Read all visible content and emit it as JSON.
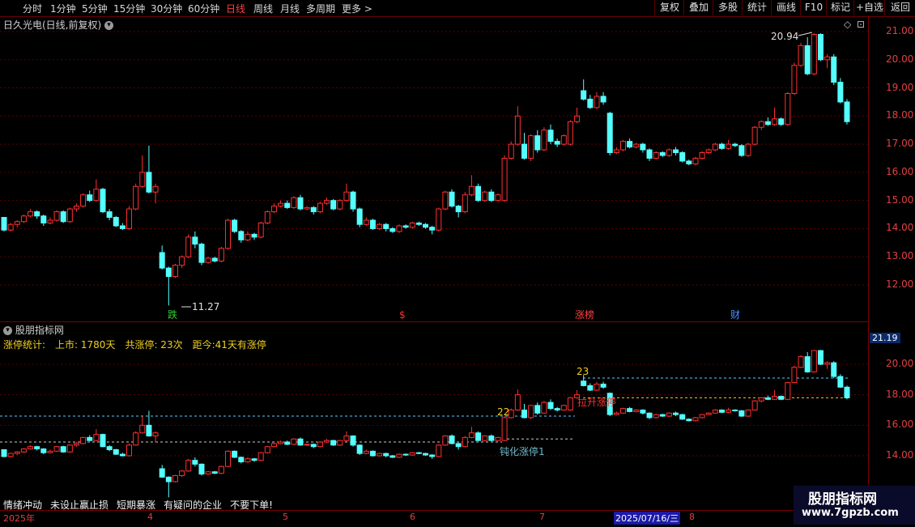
{
  "toolbar": {
    "periods": [
      "分时",
      "1分钟",
      "5分钟",
      "15分钟",
      "30分钟",
      "60分钟",
      "日线",
      "周线",
      "月线",
      "多周期",
      "更多 >"
    ],
    "active_period": "日线",
    "right_buttons": [
      "复权",
      "叠加",
      "多股",
      "统计",
      "画线",
      "F10",
      "标记",
      "+自选",
      "返回"
    ]
  },
  "main_chart": {
    "title": "日久光电(日线,前复权)",
    "high_label": "20.94",
    "low_label": "11.27",
    "events": [
      "跌",
      "$",
      "涨榜",
      "财"
    ]
  },
  "sub_chart": {
    "title": "股朋指标网",
    "stats": {
      "label": "涨停统计:",
      "listed": "上市: 1780天",
      "total": "共涨停: 23次",
      "since": "距今:41天有涨停"
    },
    "annotations": {
      "n22": "22",
      "n23": "23",
      "lashen": "拉升涨停",
      "duanhua": "钝化涨停1"
    },
    "current_price": "21.19",
    "bottom_note": [
      "情绪冲动",
      "未设止赢止损",
      "短期暴涨",
      "有疑问的企业",
      "不要下单!"
    ]
  },
  "x_axis": {
    "year": "2025年",
    "m4": "4",
    "m5": "5",
    "m6": "6",
    "m7": "7",
    "m8": "8",
    "highlight_date": "2025/07/16/三"
  },
  "watermark": {
    "name": "股朋指标网",
    "url": "www.7gpzb.com"
  },
  "colors": {
    "up": "#ff3030",
    "down": "#54ffff",
    "grid": "#5a0000",
    "accent_yellow": "#f0d020"
  },
  "chart_data": {
    "type": "candlestick",
    "title": "日久光电(日线,前复权)",
    "ylim": [
      11.5,
      21.3
    ],
    "yticks": [
      12.0,
      13.0,
      14.0,
      15.0,
      16.0,
      17.0,
      18.0,
      19.0,
      20.0,
      21.0
    ],
    "sub_ylim": [
      12.0,
      22.0
    ],
    "sub_yticks": [
      14.0,
      16.0,
      18.0,
      20.0
    ],
    "candles": [
      [
        14.4,
        13.95,
        14.4,
        13.9
      ],
      [
        13.95,
        14.15,
        14.2,
        13.9
      ],
      [
        14.15,
        14.25,
        14.3,
        14.05
      ],
      [
        14.25,
        14.45,
        14.5,
        14.2
      ],
      [
        14.45,
        14.6,
        14.7,
        14.4
      ],
      [
        14.6,
        14.45,
        14.65,
        14.35
      ],
      [
        14.45,
        14.2,
        14.5,
        14.1
      ],
      [
        14.2,
        14.3,
        14.4,
        14.15
      ],
      [
        14.3,
        14.6,
        14.65,
        14.25
      ],
      [
        14.6,
        14.25,
        14.65,
        14.2
      ],
      [
        14.25,
        14.7,
        14.75,
        14.2
      ],
      [
        14.7,
        14.8,
        14.9,
        14.6
      ],
      [
        14.8,
        15.2,
        15.25,
        14.75
      ],
      [
        15.2,
        15.0,
        15.35,
        14.95
      ],
      [
        15.0,
        15.4,
        15.75,
        14.95
      ],
      [
        15.4,
        14.6,
        15.45,
        14.55
      ],
      [
        14.6,
        14.4,
        14.7,
        14.3
      ],
      [
        14.4,
        14.1,
        14.45,
        14.05
      ],
      [
        14.1,
        14.0,
        14.2,
        13.95
      ],
      [
        14.0,
        14.7,
        14.8,
        13.95
      ],
      [
        14.7,
        15.5,
        15.6,
        14.65
      ],
      [
        15.5,
        16.0,
        16.6,
        15.45
      ],
      [
        16.0,
        15.3,
        16.95,
        15.25
      ],
      [
        15.3,
        15.5,
        15.6,
        14.9
      ],
      [
        13.15,
        12.6,
        13.4,
        12.55
      ],
      [
        12.6,
        12.3,
        12.65,
        11.27
      ],
      [
        12.3,
        12.7,
        12.75,
        12.25
      ],
      [
        12.7,
        13.0,
        13.05,
        12.6
      ],
      [
        13.0,
        13.7,
        13.8,
        12.95
      ],
      [
        13.7,
        13.45,
        13.9,
        13.3
      ],
      [
        13.45,
        12.8,
        13.5,
        12.7
      ],
      [
        12.8,
        12.95,
        13.0,
        12.75
      ],
      [
        12.95,
        12.85,
        13.0,
        12.8
      ],
      [
        12.85,
        13.3,
        13.35,
        12.8
      ],
      [
        13.3,
        14.3,
        14.35,
        13.25
      ],
      [
        14.3,
        13.9,
        14.35,
        13.85
      ],
      [
        13.9,
        13.6,
        13.95,
        13.5
      ],
      [
        13.6,
        13.8,
        13.9,
        13.55
      ],
      [
        13.8,
        13.7,
        13.85,
        13.6
      ],
      [
        13.7,
        14.2,
        14.25,
        13.65
      ],
      [
        14.2,
        14.6,
        14.65,
        14.15
      ],
      [
        14.6,
        14.8,
        14.9,
        14.55
      ],
      [
        14.8,
        14.9,
        15.0,
        14.75
      ],
      [
        14.9,
        14.75,
        15.0,
        14.7
      ],
      [
        14.75,
        15.1,
        15.15,
        14.7
      ],
      [
        15.1,
        14.7,
        15.2,
        14.65
      ],
      [
        14.7,
        14.75,
        14.8,
        14.65
      ],
      [
        14.75,
        14.6,
        14.8,
        14.5
      ],
      [
        14.6,
        14.9,
        14.95,
        14.55
      ],
      [
        14.9,
        15.0,
        15.1,
        14.85
      ],
      [
        15.0,
        14.7,
        15.05,
        14.65
      ],
      [
        14.7,
        15.0,
        15.05,
        14.65
      ],
      [
        15.0,
        15.3,
        15.6,
        14.95
      ],
      [
        15.3,
        14.7,
        15.35,
        14.6
      ],
      [
        14.7,
        14.15,
        14.75,
        14.05
      ],
      [
        14.15,
        14.3,
        14.4,
        14.1
      ],
      [
        14.3,
        14.0,
        14.35,
        13.95
      ],
      [
        14.0,
        14.15,
        14.2,
        13.95
      ],
      [
        14.15,
        14.0,
        14.2,
        13.9
      ],
      [
        14.0,
        13.9,
        14.05,
        13.85
      ],
      [
        13.9,
        14.1,
        14.15,
        13.85
      ],
      [
        14.1,
        14.05,
        14.15,
        14.0
      ],
      [
        14.05,
        14.2,
        14.25,
        14.0
      ],
      [
        14.2,
        14.15,
        14.25,
        14.1
      ],
      [
        14.15,
        14.05,
        14.2,
        14.0
      ],
      [
        14.05,
        13.95,
        14.1,
        13.8
      ],
      [
        13.95,
        14.7,
        14.75,
        13.9
      ],
      [
        14.7,
        15.3,
        15.35,
        14.65
      ],
      [
        15.3,
        14.8,
        15.4,
        14.75
      ],
      [
        14.8,
        14.6,
        14.85,
        14.4
      ],
      [
        14.6,
        15.2,
        15.3,
        14.55
      ],
      [
        15.2,
        15.5,
        15.9,
        15.15
      ],
      [
        15.5,
        15.0,
        15.6,
        14.95
      ],
      [
        15.0,
        15.3,
        15.35,
        14.95
      ],
      [
        15.3,
        15.0,
        15.4,
        14.95
      ],
      [
        15.0,
        15.2,
        15.25,
        14.95
      ],
      [
        15.0,
        16.5,
        16.6,
        14.95
      ],
      [
        16.5,
        17.0,
        17.1,
        16.45
      ],
      [
        17.0,
        18.0,
        18.35,
        16.95
      ],
      [
        17.0,
        16.5,
        17.4,
        16.45
      ],
      [
        16.5,
        17.3,
        17.35,
        16.4
      ],
      [
        17.3,
        16.8,
        17.5,
        16.7
      ],
      [
        16.8,
        17.5,
        17.6,
        16.75
      ],
      [
        17.5,
        17.1,
        17.7,
        17.0
      ],
      [
        17.1,
        17.0,
        17.2,
        16.9
      ],
      [
        17.0,
        17.3,
        17.35,
        16.95
      ],
      [
        17.0,
        17.8,
        17.85,
        16.95
      ],
      [
        17.8,
        18.0,
        18.3,
        17.75
      ],
      [
        18.9,
        18.6,
        19.3,
        18.55
      ],
      [
        18.6,
        18.3,
        18.75,
        18.25
      ],
      [
        18.3,
        18.7,
        18.85,
        18.25
      ],
      [
        18.7,
        18.5,
        18.85,
        18.4
      ],
      [
        18.1,
        16.7,
        18.15,
        16.6
      ],
      [
        16.7,
        16.8,
        16.9,
        16.65
      ],
      [
        16.8,
        17.1,
        17.15,
        16.75
      ],
      [
        17.1,
        16.9,
        17.2,
        16.85
      ],
      [
        16.9,
        17.0,
        17.05,
        16.85
      ],
      [
        17.0,
        16.8,
        17.05,
        16.7
      ],
      [
        16.8,
        16.5,
        16.85,
        16.4
      ],
      [
        16.5,
        16.7,
        16.75,
        16.45
      ],
      [
        16.7,
        16.6,
        16.75,
        16.55
      ],
      [
        16.6,
        16.8,
        16.85,
        16.55
      ],
      [
        16.8,
        16.7,
        16.9,
        16.6
      ],
      [
        16.7,
        16.4,
        16.75,
        16.35
      ],
      [
        16.4,
        16.3,
        16.45,
        16.25
      ],
      [
        16.3,
        16.5,
        16.55,
        16.25
      ],
      [
        16.5,
        16.7,
        16.75,
        16.45
      ],
      [
        16.7,
        16.8,
        16.85,
        16.65
      ],
      [
        16.8,
        17.0,
        17.05,
        16.75
      ],
      [
        17.0,
        16.85,
        17.05,
        16.8
      ],
      [
        16.85,
        17.0,
        17.15,
        16.8
      ],
      [
        17.0,
        16.95,
        17.05,
        16.9
      ],
      [
        16.95,
        16.6,
        17.0,
        16.55
      ],
      [
        16.6,
        17.0,
        17.05,
        16.55
      ],
      [
        17.0,
        17.6,
        17.65,
        16.95
      ],
      [
        17.6,
        17.8,
        17.85,
        17.5
      ],
      [
        17.8,
        17.7,
        17.95,
        17.65
      ],
      [
        17.7,
        17.9,
        18.3,
        17.65
      ],
      [
        17.9,
        17.7,
        17.95,
        17.65
      ],
      [
        17.7,
        18.8,
        18.85,
        17.65
      ],
      [
        18.8,
        19.8,
        19.9,
        18.75
      ],
      [
        19.8,
        20.5,
        20.6,
        19.75
      ],
      [
        20.5,
        19.5,
        20.8,
        19.45
      ],
      [
        19.5,
        20.9,
        20.94,
        19.45
      ],
      [
        20.9,
        20.0,
        20.94,
        19.95
      ],
      [
        20.0,
        20.1,
        20.2,
        19.7
      ],
      [
        20.1,
        19.2,
        20.2,
        19.1
      ],
      [
        19.2,
        18.5,
        19.35,
        18.45
      ],
      [
        18.5,
        17.8,
        18.6,
        17.7
      ]
    ],
    "events": [
      {
        "label": "跌",
        "color": "#33cc33"
      },
      {
        "label": "$",
        "color": "#ff3030"
      },
      {
        "label": "涨榜",
        "color": "#ff4040"
      },
      {
        "label": "财",
        "color": "#4a90ff"
      }
    ]
  }
}
